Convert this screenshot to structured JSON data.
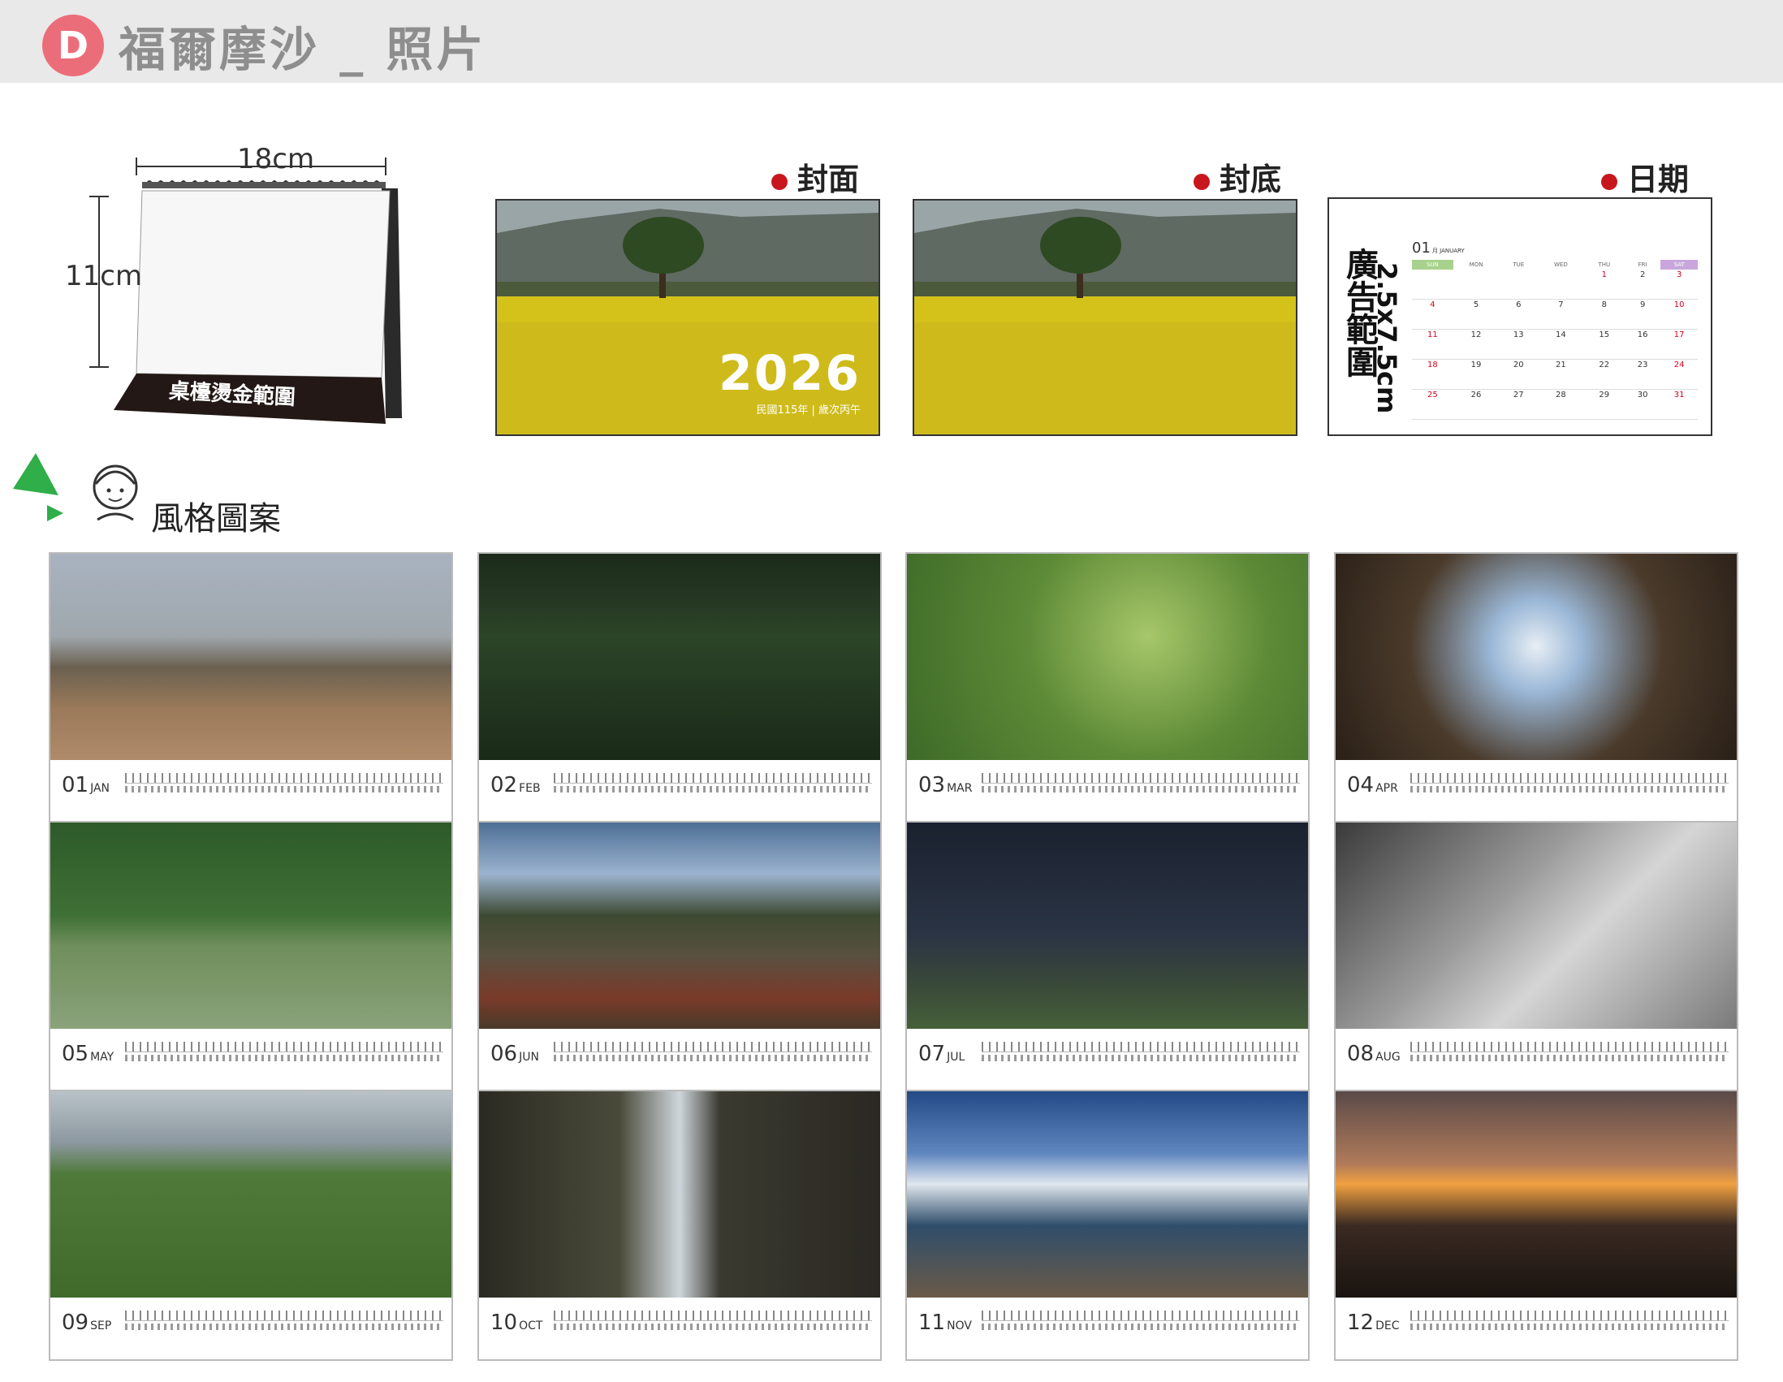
{
  "header": {
    "badge": "D",
    "title": "福爾摩沙 _ 照片"
  },
  "product": {
    "width_label": "18cm",
    "height_label": "11cm",
    "stamp_label": "桌檯燙金範圍"
  },
  "sections": {
    "cover": "封面",
    "back": "封底",
    "date": "日期"
  },
  "cover": {
    "year": "2026",
    "subtitle": "民國115年 | 歲次丙午"
  },
  "date_preview": {
    "ad_label": "廣告範圍",
    "ad_size": "2.5x7.5cm",
    "month_num": "01",
    "month_name": "月 JANUARY",
    "weekdays": [
      "SUN",
      "MON",
      "TUE",
      "WED",
      "THU",
      "FRI",
      "SAT"
    ],
    "weeks": [
      [
        "",
        "",
        "",
        "",
        "1",
        "2",
        "3"
      ],
      [
        "4",
        "5",
        "6",
        "7",
        "8",
        "9",
        "10"
      ],
      [
        "11",
        "12",
        "13",
        "14",
        "15",
        "16",
        "17"
      ],
      [
        "18",
        "19",
        "20",
        "21",
        "22",
        "23",
        "24"
      ],
      [
        "25",
        "26",
        "27",
        "28",
        "29",
        "30",
        "31"
      ]
    ]
  },
  "style_label": "風格圖案",
  "months": [
    {
      "num": "01",
      "abbr": "JAN"
    },
    {
      "num": "02",
      "abbr": "FEB"
    },
    {
      "num": "03",
      "abbr": "MAR"
    },
    {
      "num": "04",
      "abbr": "APR"
    },
    {
      "num": "05",
      "abbr": "MAY"
    },
    {
      "num": "06",
      "abbr": "JUN"
    },
    {
      "num": "07",
      "abbr": "JUL"
    },
    {
      "num": "08",
      "abbr": "AUG"
    },
    {
      "num": "09",
      "abbr": "SEP"
    },
    {
      "num": "10",
      "abbr": "OCT"
    },
    {
      "num": "11",
      "abbr": "NOV"
    },
    {
      "num": "12",
      "abbr": "DEC"
    }
  ]
}
